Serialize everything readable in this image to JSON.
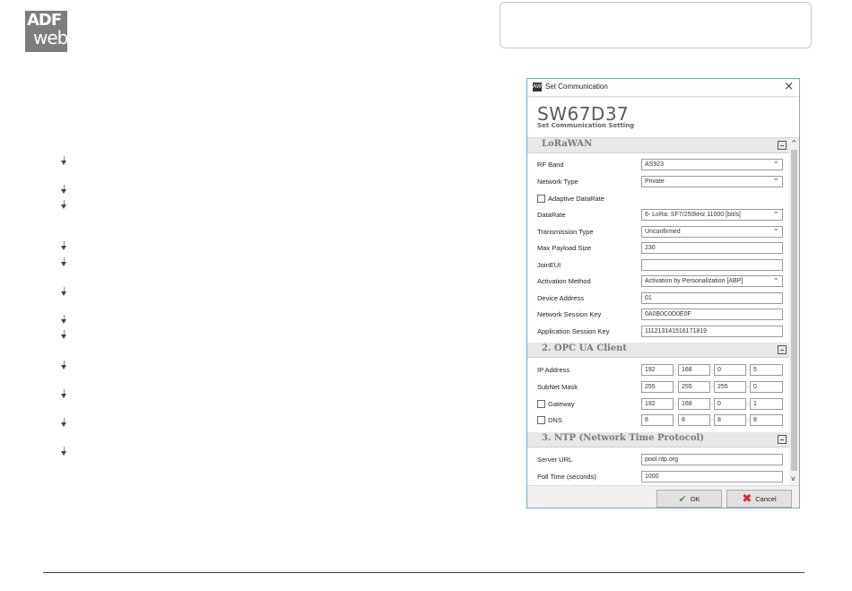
{
  "logo": {
    "line1": "ADF",
    "line2": "web"
  },
  "dialog": {
    "window_title": "Set Communication",
    "app_icon_text": "AW",
    "close_glyph": "×",
    "header_title": "SW67D37",
    "header_subtitle": "Set Communication Setting",
    "sections": {
      "lorawan": "LoRaWAN",
      "opcua": "2. OPC UA Client",
      "ntp": "3. NTP (Network Time Protocol)"
    },
    "lorawan": {
      "rf_band": {
        "label": "RF Band",
        "value": "AS923"
      },
      "network_type": {
        "label": "Network Type",
        "value": "Private"
      },
      "adaptive_datarate": {
        "label": "Adaptive DataRate",
        "checked": false
      },
      "datarate": {
        "label": "DataRate",
        "value": "6- LoRa: SF7/250kHz 11000 [bit/s]"
      },
      "transmission_type": {
        "label": "Transmission Type",
        "value": "Unconfirmed"
      },
      "max_payload_size": {
        "label": "Max Payload Size",
        "value": "230"
      },
      "join_eui": {
        "label": "JoinEUI",
        "value": ""
      },
      "activation_method": {
        "label": "Activation Method",
        "value": "Activation by Personalization [ABP]"
      },
      "device_address": {
        "label": "Device Address",
        "value": "01"
      },
      "network_session_key": {
        "label": "Network Session Key",
        "value": "0A0B0C0D0E0F"
      },
      "application_session_key": {
        "label": "Application Session Key",
        "value": "111213141516171819"
      }
    },
    "opcua": {
      "ip_address": {
        "label": "IP Address",
        "octets": [
          "192",
          "168",
          "0",
          "5"
        ]
      },
      "subnet_mask": {
        "label": "SubNet Mask",
        "octets": [
          "255",
          "255",
          "255",
          "0"
        ]
      },
      "gateway": {
        "label": "Gateway",
        "checked": false,
        "octets": [
          "192",
          "168",
          "0",
          "1"
        ]
      },
      "dns": {
        "label": "DNS",
        "checked": false,
        "octets": [
          "8",
          "8",
          "8",
          "8"
        ]
      }
    },
    "ntp": {
      "server_url": {
        "label": "Server URL",
        "value": "pool.ntp.org"
      },
      "poll_time": {
        "label": "Poll Time (seconds)",
        "value": "1000"
      }
    },
    "buttons": {
      "ok": "OK",
      "cancel": "Cancel"
    },
    "scroll_arrows": {
      "up": "^",
      "down": "v"
    },
    "ip_separator": "."
  },
  "icons": {
    "bullet": "arrow-down-bullet-icon",
    "ok": "checkmark-icon",
    "cancel": "red-x-icon",
    "collapse": "minus-box-icon"
  },
  "colors": {
    "dialog_border": "#7aa7d0",
    "ok_green": "#3fa535",
    "cancel_red": "#d8232a",
    "section_text": "#7a7a7a"
  }
}
